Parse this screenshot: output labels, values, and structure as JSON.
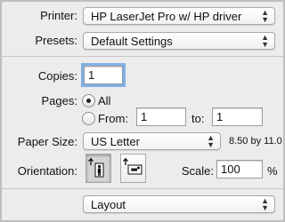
{
  "printer": {
    "label": "Printer:",
    "value": "HP LaserJet Pro w/ HP driver"
  },
  "presets": {
    "label": "Presets:",
    "value": "Default Settings"
  },
  "copies": {
    "label": "Copies:",
    "value": "1"
  },
  "pages": {
    "label": "Pages:",
    "all_label": "All",
    "from_label": "From:",
    "from_value": "1",
    "to_label": "to:",
    "to_value": "1",
    "selected": "All"
  },
  "paper_size": {
    "label": "Paper Size:",
    "value": "US Letter",
    "dimensions": "8.50 by 11.0"
  },
  "orientation": {
    "label": "Orientation:",
    "selected": "portrait"
  },
  "scale": {
    "label": "Scale:",
    "value": "100",
    "unit": "%"
  },
  "section_popup": {
    "value": "Layout"
  },
  "icons": {
    "popup_arrows": "updown-chevron-icon",
    "dropdown_arrow": "chevron-down-icon",
    "portrait": "portrait-orientation-icon",
    "landscape": "landscape-orientation-icon"
  },
  "colors": {
    "focus_ring": "#7fb0e6",
    "background": "#ececec"
  }
}
